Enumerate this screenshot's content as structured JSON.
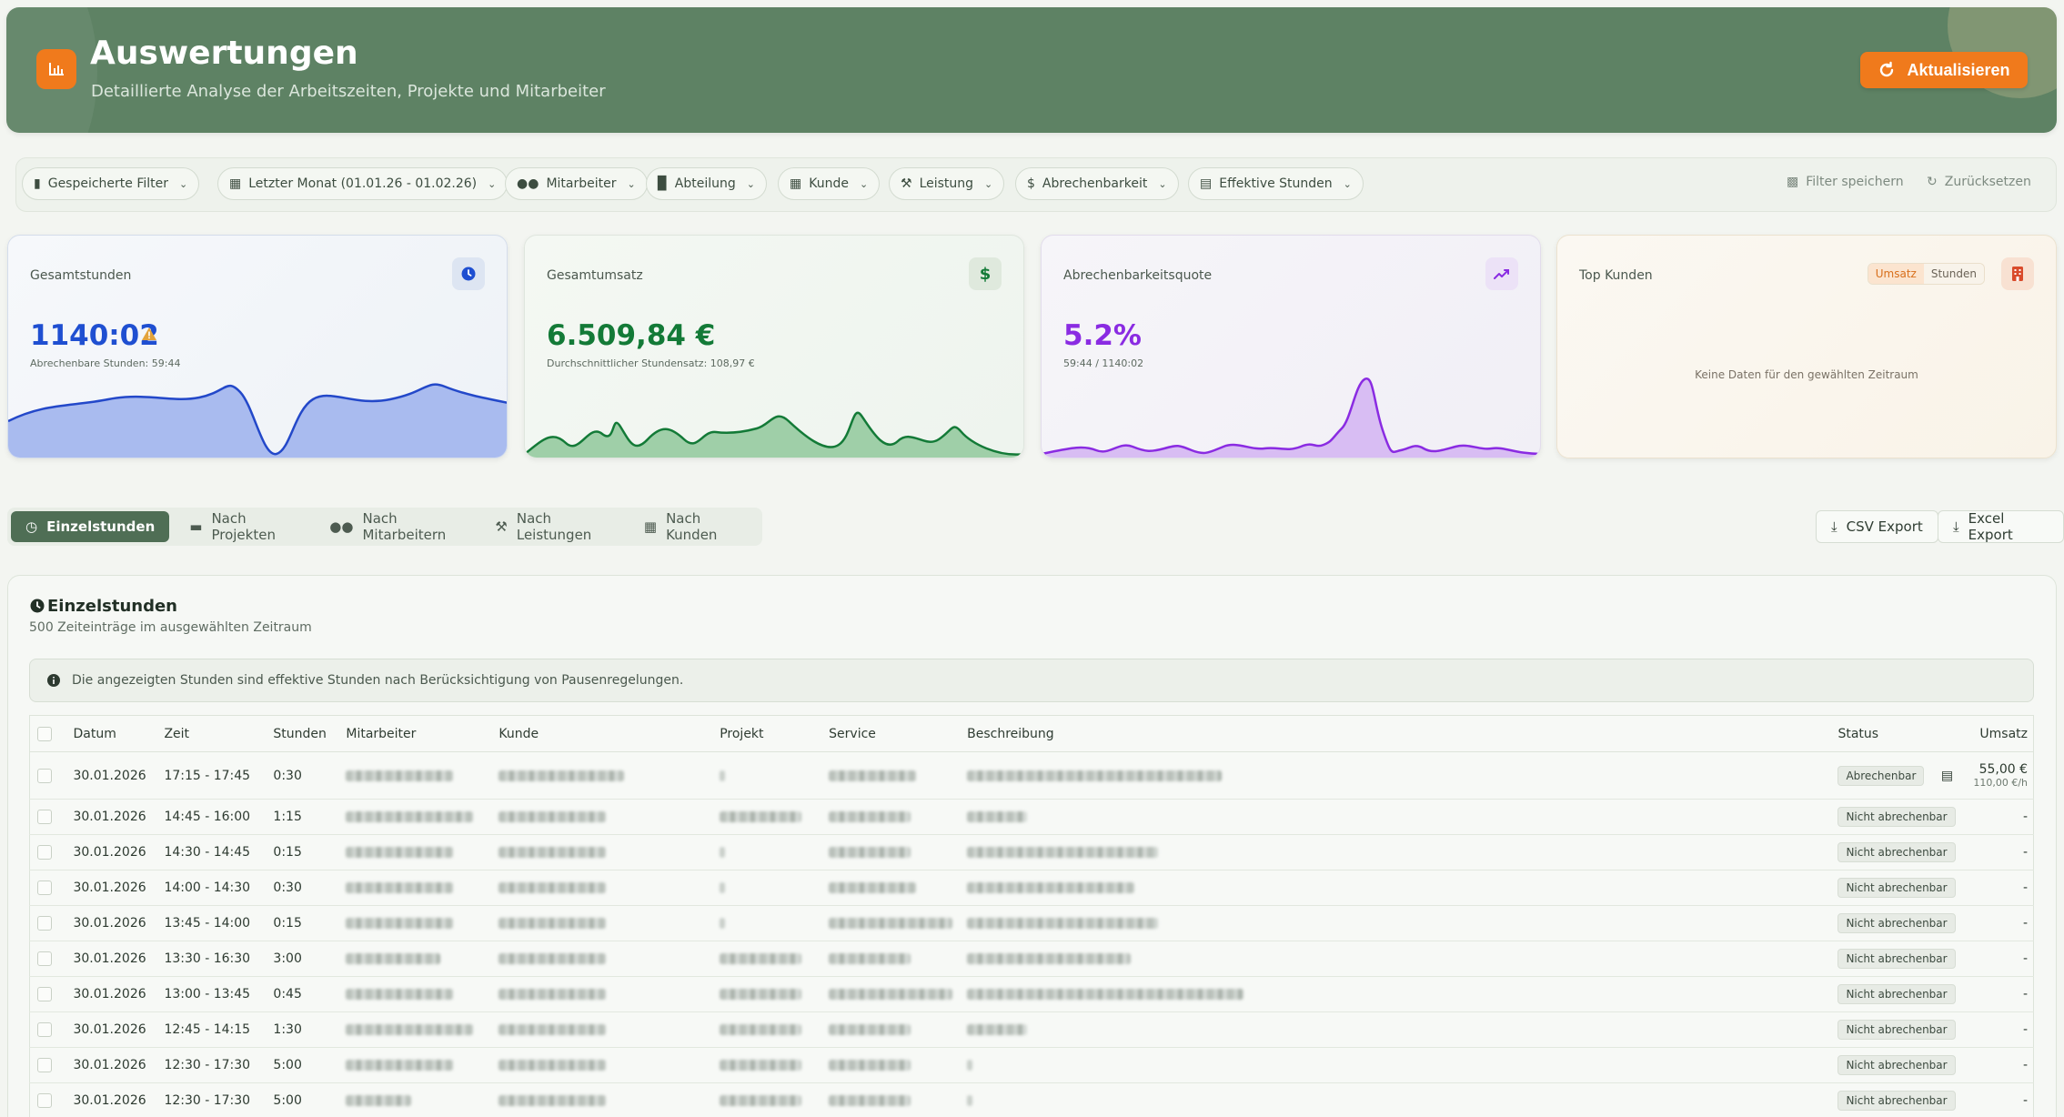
{
  "header": {
    "title": "Auswertungen",
    "subtitle": "Detaillierte Analyse der Arbeitszeiten, Projekte und Mitarbeiter",
    "refresh_label": "Aktualisieren",
    "accent": "#f07a1c",
    "bg": "#5e8264"
  },
  "filters": {
    "chips": [
      {
        "label": "Gespeicherte Filter",
        "icon": "bookmark-icon"
      },
      {
        "label": "Letzter Monat (01.01.26 - 01.02.26)",
        "icon": "calendar-icon"
      },
      {
        "label": "Mitarbeiter",
        "icon": "users-icon"
      },
      {
        "label": "Abteilung",
        "icon": "chart-icon"
      },
      {
        "label": "Kunde",
        "icon": "building-icon"
      },
      {
        "label": "Leistung",
        "icon": "wrench-icon"
      },
      {
        "label": "Abrechenbarkeit",
        "icon": "dollar-icon"
      },
      {
        "label": "Effektive Stunden",
        "icon": "calculator-icon"
      }
    ],
    "save_label": "Filter speichern",
    "reset_label": "Zurücksetzen"
  },
  "kpis": {
    "hours": {
      "title": "Gesamtstunden",
      "value": "1140:02",
      "sub": "Abrechenbare Stunden: 59:44",
      "color": "#1f4fd1"
    },
    "revenue": {
      "title": "Gesamtumsatz",
      "value": "6.509,84 €",
      "sub": "Durchschnittlicher Stundensatz: 108,97 €",
      "color": "#137a37"
    },
    "quota": {
      "title": "Abrechenbarkeitsquote",
      "value": "5.2%",
      "sub": "59:44 / 1140:02",
      "color": "#8a2be2"
    },
    "top": {
      "title": "Top Kunden",
      "toggle_on": "Umsatz",
      "toggle_off": "Stunden",
      "empty": "Keine Daten für den gewählten Zeitraum"
    }
  },
  "tabs": [
    "Einzelstunden",
    "Nach Projekten",
    "Nach Mitarbeitern",
    "Nach Leistungen",
    "Nach Kunden"
  ],
  "exports": {
    "csv": "CSV Export",
    "excel": "Excel Export"
  },
  "panel": {
    "title": "Einzelstunden",
    "subtitle": "500 Zeiteinträge im ausgewählten Zeitraum",
    "info": "Die angezeigten Stunden sind effektive Stunden nach Berücksichtigung von Pausenregelungen."
  },
  "table": {
    "columns": [
      "Datum",
      "Zeit",
      "Stunden",
      "Mitarbeiter",
      "Kunde",
      "Projekt",
      "Service",
      "Beschreibung",
      "Status",
      "Umsatz"
    ],
    "rows": [
      {
        "date": "30.01.2026",
        "time": "17:15 - 17:45",
        "hours": "0:30",
        "status": "Abrechenbar",
        "amount": "55,00 €",
        "rate": "110,00 €/h"
      },
      {
        "date": "30.01.2026",
        "time": "14:45 - 16:00",
        "hours": "1:15",
        "status": "Nicht abrechenbar",
        "amount": "-"
      },
      {
        "date": "30.01.2026",
        "time": "14:30 - 14:45",
        "hours": "0:15",
        "status": "Nicht abrechenbar",
        "amount": "-"
      },
      {
        "date": "30.01.2026",
        "time": "14:00 - 14:30",
        "hours": "0:30",
        "status": "Nicht abrechenbar",
        "amount": "-"
      },
      {
        "date": "30.01.2026",
        "time": "13:45 - 14:00",
        "hours": "0:15",
        "status": "Nicht abrechenbar",
        "amount": "-"
      },
      {
        "date": "30.01.2026",
        "time": "13:30 - 16:30",
        "hours": "3:00",
        "status": "Nicht abrechenbar",
        "amount": "-"
      },
      {
        "date": "30.01.2026",
        "time": "13:00 - 13:45",
        "hours": "0:45",
        "status": "Nicht abrechenbar",
        "amount": "-"
      },
      {
        "date": "30.01.2026",
        "time": "12:45 - 14:15",
        "hours": "1:30",
        "status": "Nicht abrechenbar",
        "amount": "-"
      },
      {
        "date": "30.01.2026",
        "time": "12:30 - 17:30",
        "hours": "5:00",
        "status": "Nicht abrechenbar",
        "amount": "-"
      },
      {
        "date": "30.01.2026",
        "time": "12:30 - 17:30",
        "hours": "5:00",
        "status": "Nicht abrechenbar",
        "amount": "-"
      }
    ]
  }
}
